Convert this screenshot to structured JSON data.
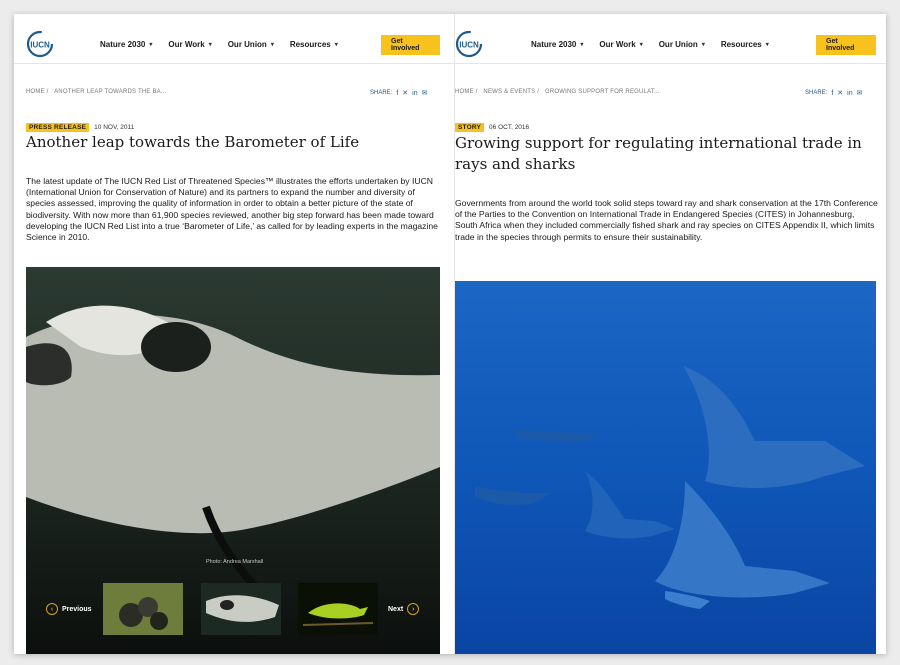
{
  "brand": {
    "logo_text": "IUCN",
    "color": "#1f5a8a",
    "accent": "#f7c21b"
  },
  "nav": {
    "items": [
      "Nature 2030",
      "Our Work",
      "Our Union",
      "Resources"
    ],
    "cta": "Get Involved"
  },
  "left": {
    "breadcrumb": [
      "HOME /",
      "ANOTHER LEAP TOWARDS THE BA..."
    ],
    "share_label": "SHARE:",
    "share_icons": [
      "facebook-icon",
      "x-icon",
      "linkedin-icon",
      "mail-icon"
    ],
    "tag": "PRESS RELEASE",
    "date": "10 NOV, 2011",
    "title": "Another leap towards the Barometer of Life",
    "body": "The latest update of The IUCN Red List of Threatened Species™ illustrates the efforts undertaken by IUCN (International Union for Conservation of Nature) and its partners to expand the number and diversity of species assessed, improving the quality of information in order to obtain a better picture of the state of biodiversity. With now more than 61,900 species reviewed, another big step forward has been made toward developing the IUCN Red List into a true ‘Barometer of Life,’ as called for by leading experts in the magazine Science in 2010.",
    "photo_caption": "Photo: Andrea Marshall",
    "gallery": {
      "prev": "Previous",
      "next": "Next"
    }
  },
  "right": {
    "breadcrumb": [
      "HOME /",
      "NEWS & EVENTS /",
      "GROWING SUPPORT FOR REGULAT..."
    ],
    "share_label": "SHARE:",
    "share_icons": [
      "facebook-icon",
      "x-icon",
      "linkedin-icon",
      "mail-icon"
    ],
    "tag": "STORY",
    "date": "06 OCT, 2016",
    "title": "Growing support for regulating international trade in rays and sharks",
    "body": "Governments from around the world took solid steps toward ray and shark conservation at the 17th Conference of the Parties to the Convention on International Trade in Endangered Species (CITES) in Johannesburg, South Africa when they included commercially fished shark and ray species on CITES Appendix II, which limits trade in the species through permits to ensure their sustainability."
  }
}
